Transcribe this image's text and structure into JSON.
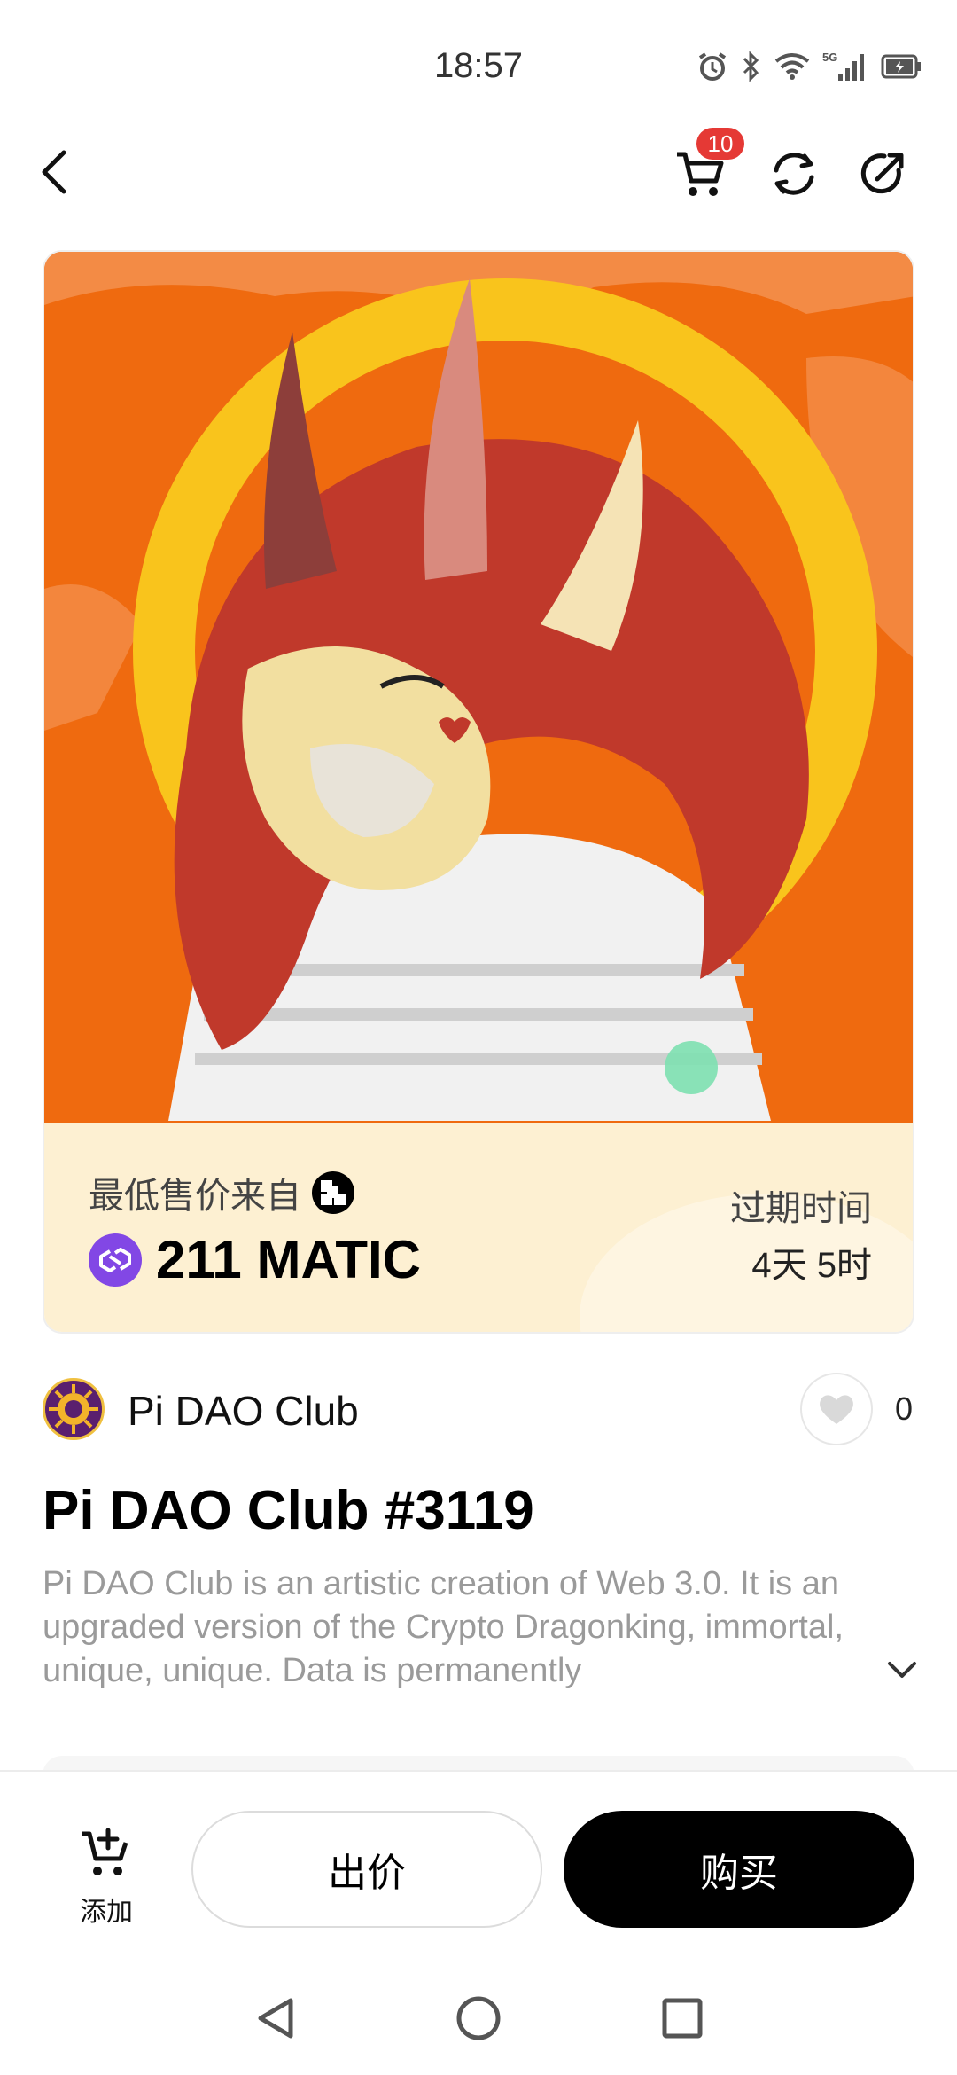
{
  "status_bar": {
    "time": "18:57",
    "icons": [
      "alarm-icon",
      "bluetooth-icon",
      "wifi-icon",
      "5g-signal-icon",
      "battery-charging-icon"
    ],
    "network_label": "5G"
  },
  "nav": {
    "cart_badge": "10",
    "icons": [
      "back-icon",
      "cart-icon",
      "refresh-icon",
      "share-icon"
    ]
  },
  "card": {
    "lowest_price_label": "最低售价来自",
    "marketplace_icon": "okx-icon",
    "price": "211 MATIC",
    "currency_icon": "matic-icon",
    "expire_label": "过期时间",
    "expire_value": "4天 5时"
  },
  "collection": {
    "name": "Pi DAO Club",
    "like_count": "0"
  },
  "nft": {
    "title": "Pi DAO Club #3119",
    "description": "Pi DAO Club is an artistic creation of Web 3.0. It is an upgraded version of the Crypto Dragonking, immortal, unique, unique. Data is permanently"
  },
  "actions": {
    "add_label": "添加",
    "bid_label": "出价",
    "buy_label": "购买"
  },
  "colors": {
    "accent_badge": "#e53935",
    "art_background": "#ef6a0f",
    "price_panel": "#fdf0d2",
    "matic": "#8247e5"
  }
}
